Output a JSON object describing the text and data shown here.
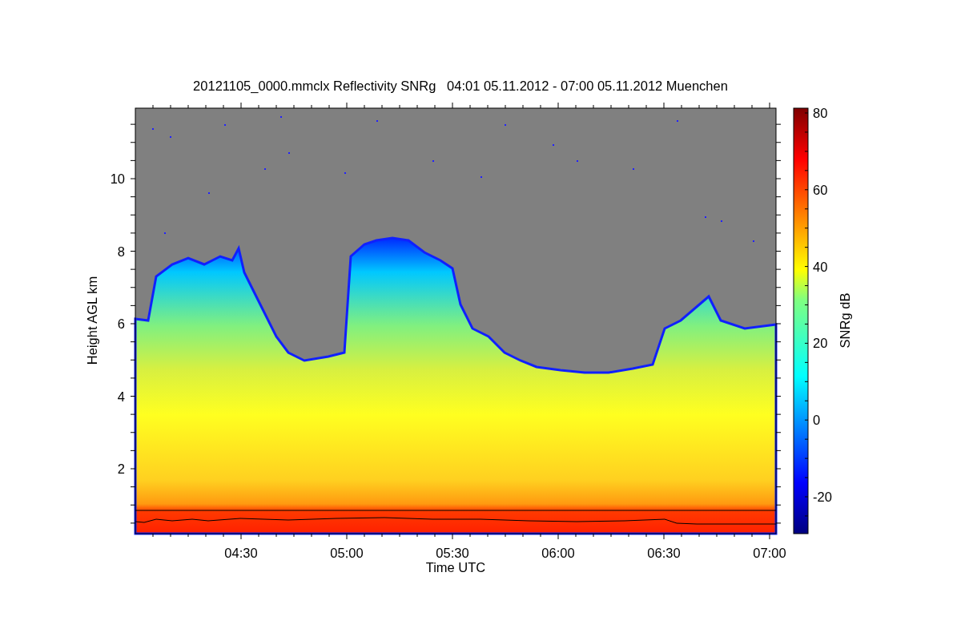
{
  "plot": {
    "title": "20121105_0000.mmclx Reflectivity SNRg   04:01 05.11.2012 - 07:00 05.11.2012 Muenchen",
    "y_axis": {
      "label": "Height AGL km",
      "ticks": [
        "10",
        "8",
        "6",
        "4",
        "2"
      ]
    },
    "x_axis": {
      "label": "Time UTC",
      "ticks": [
        "04:30",
        "05:00",
        "05:30",
        "06:00",
        "06:30",
        "07:00"
      ]
    }
  },
  "colorbar": {
    "label": "SNRg dB",
    "ticks": [
      "80",
      "60",
      "40",
      "20",
      "0",
      "-20"
    ]
  }
}
